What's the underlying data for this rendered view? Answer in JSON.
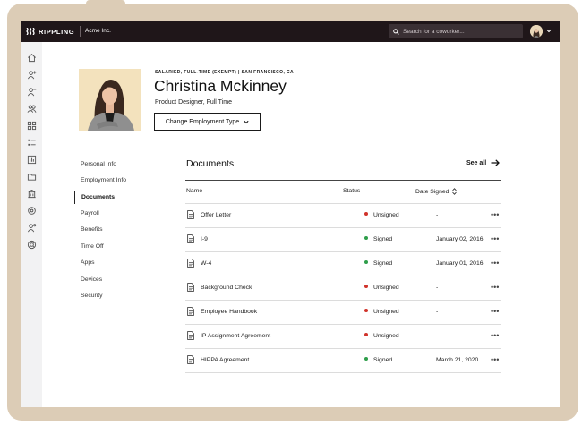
{
  "topbar": {
    "logo_text": "RIPPLING",
    "company": "Acme Inc.",
    "search_placeholder": "Search for a coworker..."
  },
  "rail_icons": [
    "home-icon",
    "add-person-icon",
    "remove-person-icon",
    "people-icon",
    "apps-grid-icon",
    "list-icon",
    "chart-icon",
    "folder-icon",
    "building-icon",
    "settings-icon",
    "person-settings-icon",
    "support-icon"
  ],
  "profile": {
    "meta": "Salaried, Full-Time (Exempt) | San Francisco, CA",
    "name": "Christina Mckinney",
    "role": "Product Designer, Full Time",
    "change_button": "Change Employment Type"
  },
  "side_nav": {
    "items": [
      {
        "label": "Personal Info",
        "active": false
      },
      {
        "label": "Employment Info",
        "active": false
      },
      {
        "label": "Documents",
        "active": true
      },
      {
        "label": "Payroll",
        "active": false
      },
      {
        "label": "Benefits",
        "active": false
      },
      {
        "label": "Time Off",
        "active": false
      },
      {
        "label": "Apps",
        "active": false
      },
      {
        "label": "Devices",
        "active": false
      },
      {
        "label": "Security",
        "active": false
      }
    ]
  },
  "documents": {
    "title": "Documents",
    "see_all": "See all",
    "columns": {
      "name": "Name",
      "status": "Status",
      "date": "Date Signed"
    },
    "rows": [
      {
        "name": "Offer Letter",
        "status": "Unsigned",
        "date": "-"
      },
      {
        "name": "I-9",
        "status": "Signed",
        "date": "January 02, 2016"
      },
      {
        "name": "W-4",
        "status": "Signed",
        "date": "January 01, 2016"
      },
      {
        "name": "Background Check",
        "status": "Unsigned",
        "date": "-"
      },
      {
        "name": "Employee Handbook",
        "status": "Unsigned",
        "date": "-"
      },
      {
        "name": "IP Assignment Agreement",
        "status": "Unsigned",
        "date": "-"
      },
      {
        "name": "HIPPA Agreement",
        "status": "Signed",
        "date": "March 21, 2020"
      }
    ],
    "more_label": "•••"
  },
  "colors": {
    "signed": "#2e9e4a",
    "unsigned": "#d0332b",
    "topbar": "#1f1619",
    "frame": "#dcccb6"
  }
}
